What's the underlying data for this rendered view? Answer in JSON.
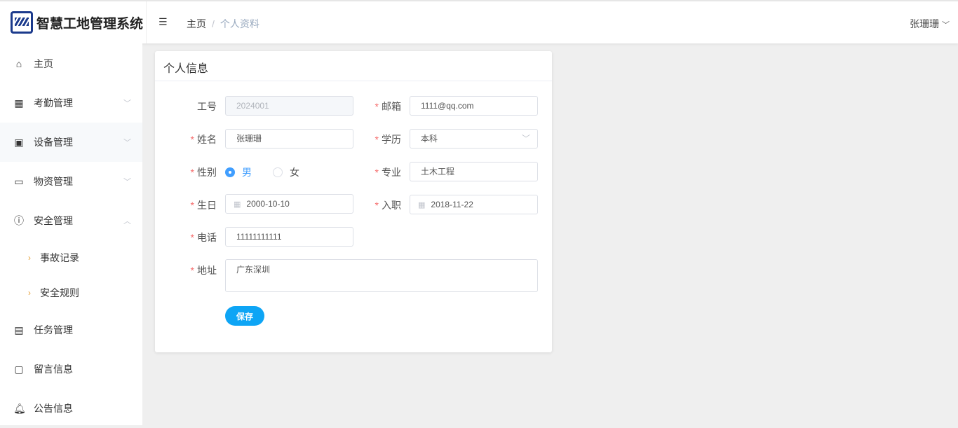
{
  "header": {
    "title": "智慧工地管理系统",
    "breadcrumb": [
      "主页",
      "个人资料"
    ],
    "user": "张珊珊"
  },
  "sidebar": {
    "items": [
      {
        "label": "主页",
        "icon": "home-icon"
      },
      {
        "label": "考勤管理",
        "icon": "calendar-icon"
      },
      {
        "label": "设备管理",
        "icon": "chip-icon"
      },
      {
        "label": "物资管理",
        "icon": "box-icon"
      },
      {
        "label": "安全管理",
        "icon": "warning-icon"
      },
      {
        "label": "任务管理",
        "icon": "task-icon"
      },
      {
        "label": "留言信息",
        "icon": "message-icon"
      },
      {
        "label": "公告信息",
        "icon": "bell-icon"
      }
    ],
    "sub_items": [
      "事故记录",
      "安全规则"
    ]
  },
  "card": {
    "title": "个人信息"
  },
  "form": {
    "id": {
      "label": "工号",
      "value": "2024001"
    },
    "email": {
      "label": "邮箱",
      "value": "1111@qq.com"
    },
    "name": {
      "label": "姓名",
      "value": "张珊珊"
    },
    "education": {
      "label": "学历",
      "value": "本科"
    },
    "gender": {
      "label": "性别",
      "options": [
        "男",
        "女"
      ],
      "selected": "男"
    },
    "major": {
      "label": "专业",
      "value": "土木工程"
    },
    "birthday": {
      "label": "生日",
      "value": "2000-10-10"
    },
    "hire_date": {
      "label": "入职",
      "value": "2018-11-22"
    },
    "phone": {
      "label": "电话",
      "value": "11111111111"
    },
    "address": {
      "label": "地址",
      "value": "广东深圳"
    },
    "required_mark": "*",
    "save_label": "保存"
  }
}
